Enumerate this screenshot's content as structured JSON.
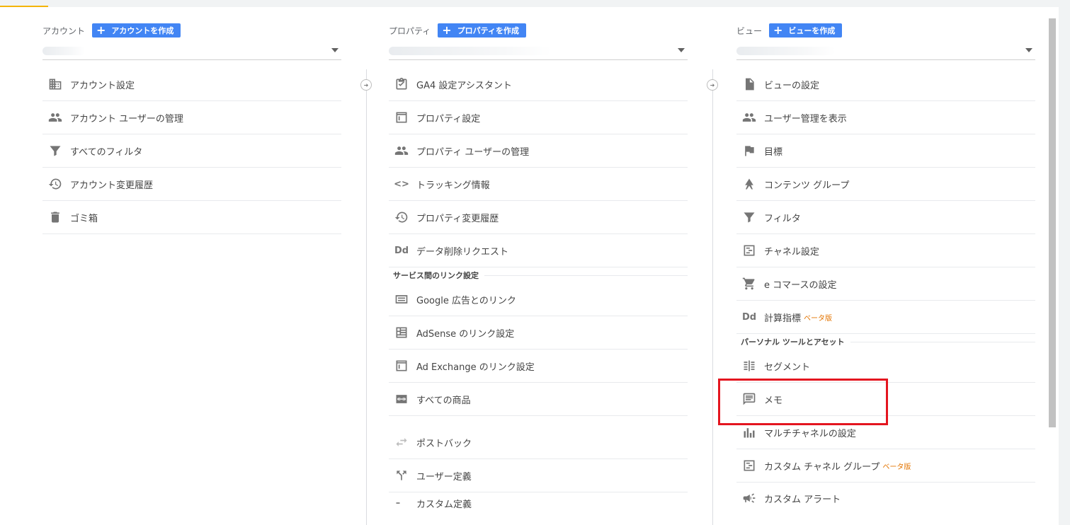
{
  "account": {
    "label": "アカウント",
    "create_label": "アカウントを作成",
    "items": [
      {
        "label": "アカウント設定",
        "icon": "building-icon"
      },
      {
        "label": "アカウント ユーザーの管理",
        "icon": "people-icon"
      },
      {
        "label": "すべてのフィルタ",
        "icon": "filter-icon"
      },
      {
        "label": "アカウント変更履歴",
        "icon": "history-icon"
      },
      {
        "label": "ゴミ箱",
        "icon": "trash-icon"
      }
    ]
  },
  "property": {
    "label": "プロパティ",
    "create_label": "プロパティを作成",
    "items": [
      {
        "label": "GA4 設定アシスタント",
        "icon": "clipboard-check-icon"
      },
      {
        "label": "プロパティ設定",
        "icon": "layout-icon"
      },
      {
        "label": "プロパティ ユーザーの管理",
        "icon": "people-icon"
      },
      {
        "label": "トラッキング情報",
        "icon": "code-icon",
        "glyph": "<>"
      },
      {
        "label": "プロパティ変更履歴",
        "icon": "history-icon"
      },
      {
        "label": "データ削除リクエスト",
        "icon": "dd-icon",
        "glyph": "Dd"
      }
    ],
    "section_title": "サービス間のリンク設定",
    "link_items": [
      {
        "label": "Google 広告とのリンク",
        "icon": "ads-icon"
      },
      {
        "label": "AdSense のリンク設定",
        "icon": "adsense-icon"
      },
      {
        "label": "Ad Exchange のリンク設定",
        "icon": "layout-icon"
      },
      {
        "label": "すべての商品",
        "icon": "link-icon"
      }
    ],
    "extra_items": [
      {
        "label": "ポストバック",
        "icon": "swap-icon"
      },
      {
        "label": "ユーザー定義",
        "icon": "fork-icon"
      },
      {
        "label": "カスタム定義",
        "icon": "custom-icon"
      }
    ]
  },
  "view": {
    "label": "ビュー",
    "create_label": "ビューを作成",
    "items": [
      {
        "label": "ビューの設定",
        "icon": "document-icon"
      },
      {
        "label": "ユーザー管理を表示",
        "icon": "people-icon"
      },
      {
        "label": "目標",
        "icon": "flag-icon"
      },
      {
        "label": "コンテンツ グループ",
        "icon": "content-group-icon"
      },
      {
        "label": "フィルタ",
        "icon": "filter-icon"
      },
      {
        "label": "チャネル設定",
        "icon": "channel-icon"
      },
      {
        "label": "e コマースの設定",
        "icon": "cart-icon"
      },
      {
        "label": "計算指標",
        "icon": "dd-icon",
        "glyph": "Dd",
        "beta": "ベータ版"
      }
    ],
    "section_title": "パーソナル ツールとアセット",
    "tool_items": [
      {
        "label": "セグメント",
        "icon": "segment-icon"
      },
      {
        "label": "メモ",
        "icon": "comment-icon"
      },
      {
        "label": "マルチチャネルの設定",
        "icon": "bar-chart-icon"
      },
      {
        "label": "カスタム チャネル グループ",
        "icon": "channel-icon",
        "beta": "ベータ版"
      },
      {
        "label": "カスタム アラート",
        "icon": "megaphone-icon"
      }
    ]
  },
  "colors": {
    "accent": "#4285f4",
    "highlight": "#e4151f",
    "beta": "#e37400",
    "top_accent": "#f4b400"
  }
}
